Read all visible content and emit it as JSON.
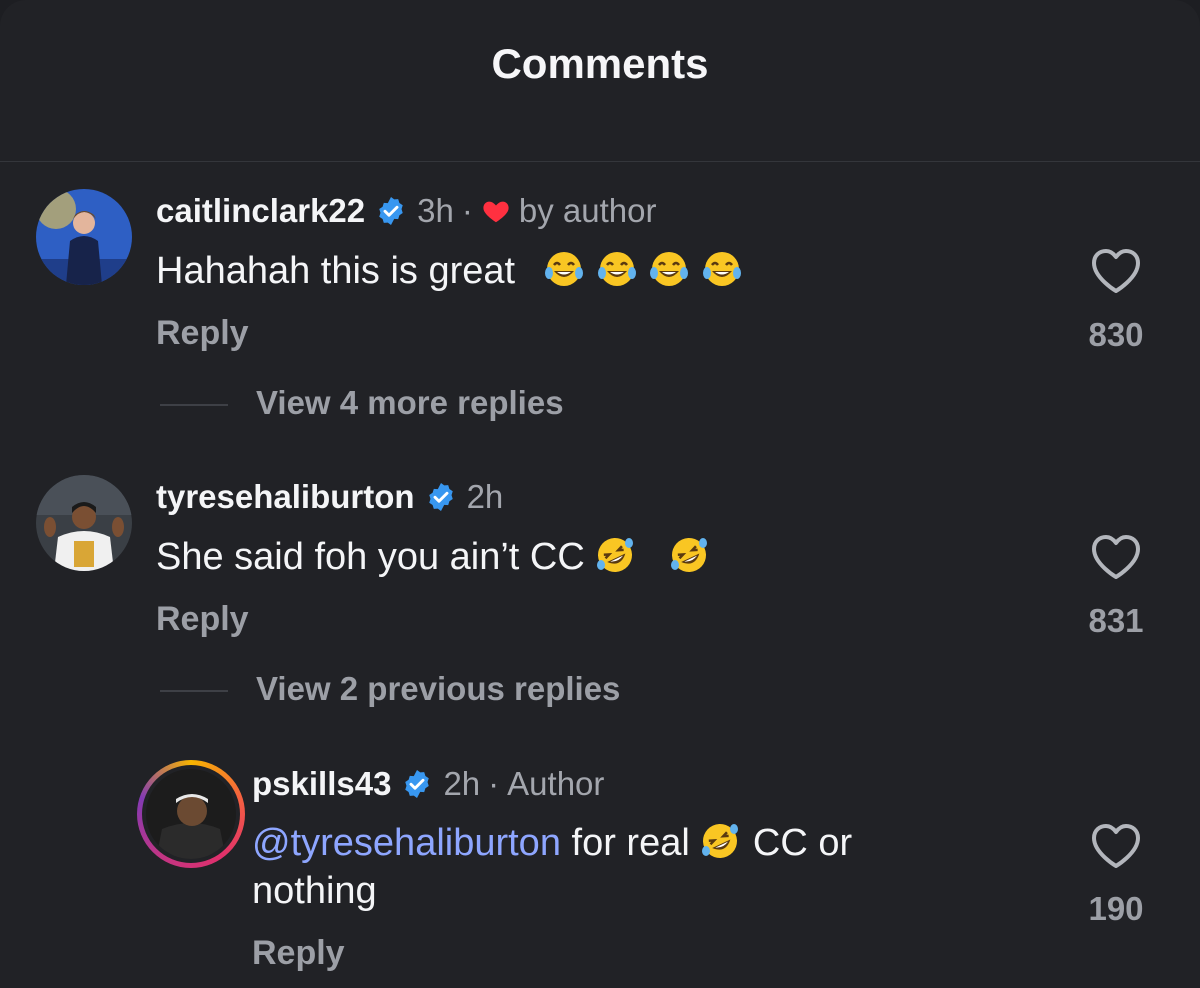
{
  "header": {
    "title": "Comments"
  },
  "comments": [
    {
      "username": "caitlinclark22",
      "time": "3h",
      "separator": "·",
      "liked_by_author_label": "by author",
      "text": "Hahahah this is great",
      "reply_label": "Reply",
      "like_count": "830",
      "view_replies_label": "View 4 more replies"
    },
    {
      "username": "tyresehaliburton",
      "time": "2h",
      "text": "She said foh you ain’t CC",
      "reply_label": "Reply",
      "like_count": "831",
      "view_replies_label": "View 2 previous replies"
    }
  ],
  "reply": {
    "username": "pskills43",
    "time": "2h",
    "separator": "·",
    "author_label": "Author",
    "mention": "@tyresehaliburton",
    "text_part1": " for real ",
    "text_part2": " CC or",
    "text_line2": "nothing",
    "reply_label": "Reply",
    "like_count": "190"
  },
  "colors": {
    "background": "#212226",
    "verified": "#3897f0",
    "heart": "#ff3040",
    "mention": "#8ea6ff"
  }
}
